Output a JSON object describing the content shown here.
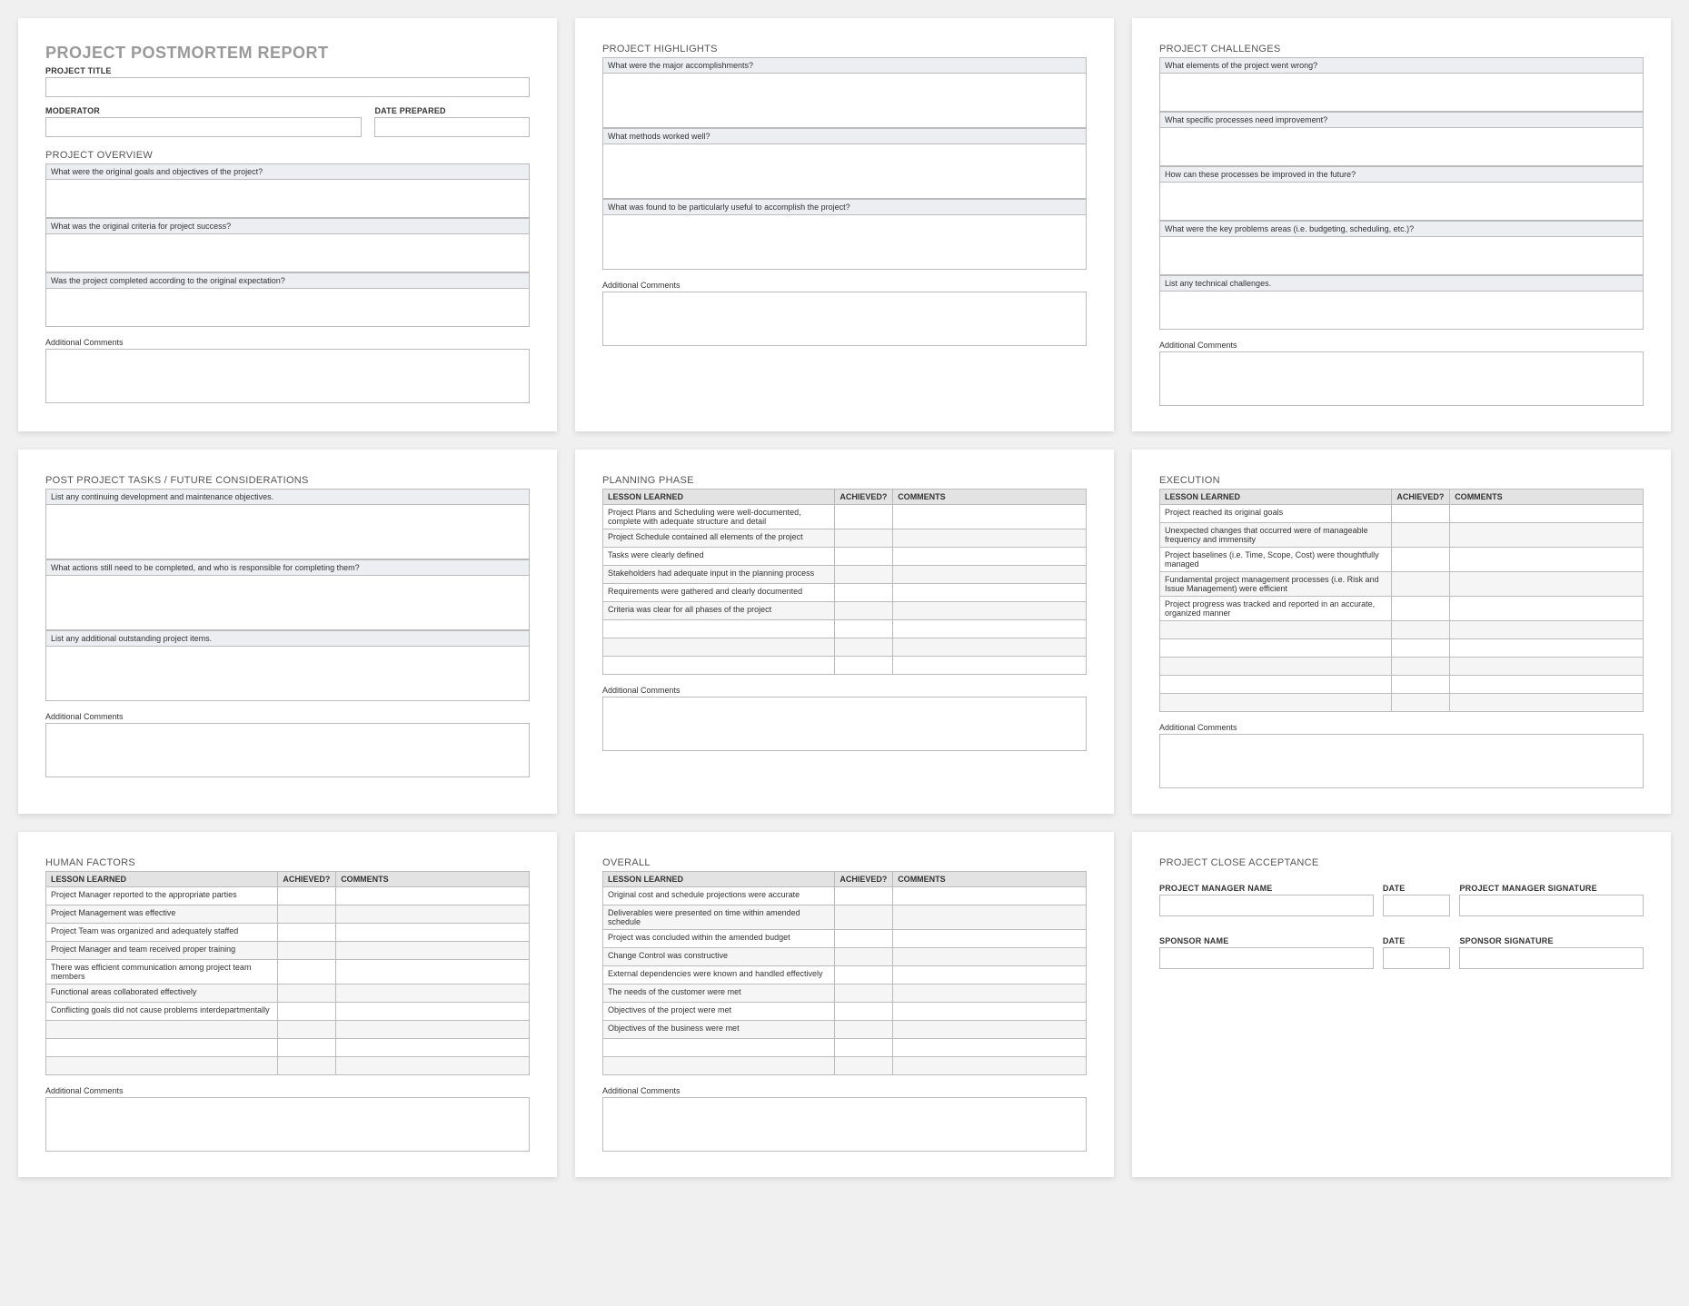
{
  "report_title": "PROJECT POSTMORTEM REPORT",
  "hdr": {
    "project_title_label": "PROJECT TITLE",
    "moderator_label": "MODERATOR",
    "date_prepared_label": "DATE PREPARED",
    "project_title": "",
    "moderator": "",
    "date_prepared": ""
  },
  "overview": {
    "heading": "PROJECT OVERVIEW",
    "q1": "What were the original goals and objectives of the project?",
    "q2": "What was the original criteria for project success?",
    "q3": "Was the project completed according to the original expectation?",
    "comments_label": "Additional Comments"
  },
  "highlights": {
    "heading": "PROJECT HIGHLIGHTS",
    "q1": "What were the major accomplishments?",
    "q2": "What methods worked well?",
    "q3": "What was found to be particularly useful to accomplish the project?",
    "comments_label": "Additional Comments"
  },
  "challenges": {
    "heading": "PROJECT CHALLENGES",
    "q1": "What elements of the project went wrong?",
    "q2": "What specific processes need improvement?",
    "q3": "How can these processes be improved in the future?",
    "q4": "What were the key problems areas (i.e. budgeting, scheduling, etc.)?",
    "q5": "List any technical challenges.",
    "comments_label": "Additional Comments"
  },
  "postproject": {
    "heading": "POST PROJECT TASKS / FUTURE CONSIDERATIONS",
    "q1": "List any continuing development and maintenance objectives.",
    "q2": "What actions still need to be completed, and who is responsible for completing them?",
    "q3": "List any additional outstanding project items.",
    "comments_label": "Additional Comments"
  },
  "table_headers": {
    "lesson": "LESSON LEARNED",
    "achieved": "ACHIEVED?",
    "comments": "COMMENTS"
  },
  "planning": {
    "heading": "PLANNING PHASE",
    "rows": [
      "Project Plans and Scheduling were well-documented, complete with adequate structure and detail",
      "Project Schedule contained all elements of the project",
      "Tasks were clearly defined",
      "Stakeholders had adequate input in the planning process",
      "Requirements were gathered and clearly documented",
      "Criteria was clear for all phases of the project",
      "",
      "",
      ""
    ],
    "comments_label": "Additional Comments"
  },
  "execution": {
    "heading": "EXECUTION",
    "rows": [
      "Project reached its original goals",
      "Unexpected changes that occurred were of manageable frequency and immensity",
      "Project baselines (i.e. Time, Scope, Cost) were thoughtfully managed",
      "Fundamental project management processes (i.e. Risk and Issue Management) were efficient",
      "Project progress was tracked and reported in an accurate, organized manner",
      "",
      "",
      "",
      "",
      ""
    ],
    "comments_label": "Additional Comments"
  },
  "human": {
    "heading": "HUMAN FACTORS",
    "rows": [
      "Project Manager reported to the appropriate parties",
      "Project Management was effective",
      "Project Team was organized and adequately staffed",
      "Project Manager and team received proper training",
      "There was efficient communication among project team members",
      "Functional areas collaborated effectively",
      "Conflicting goals did not cause problems interdepartmentally",
      "",
      "",
      ""
    ],
    "comments_label": "Additional Comments"
  },
  "overall": {
    "heading": "OVERALL",
    "rows": [
      "Original cost and schedule projections were accurate",
      "Deliverables were presented on time within amended schedule",
      "Project was concluded within the amended budget",
      "Change Control was constructive",
      "External dependencies were known and handled effectively",
      "The needs of the customer were met",
      "Objectives of the project were met",
      "Objectives of the business were met",
      "",
      ""
    ],
    "comments_label": "Additional Comments"
  },
  "close": {
    "heading": "PROJECT CLOSE ACCEPTANCE",
    "pm_name_label": "PROJECT MANAGER NAME",
    "pm_date_label": "DATE",
    "pm_sig_label": "PROJECT MANAGER SIGNATURE",
    "sp_name_label": "SPONSOR NAME",
    "sp_date_label": "DATE",
    "sp_sig_label": "SPONSOR SIGNATURE"
  }
}
